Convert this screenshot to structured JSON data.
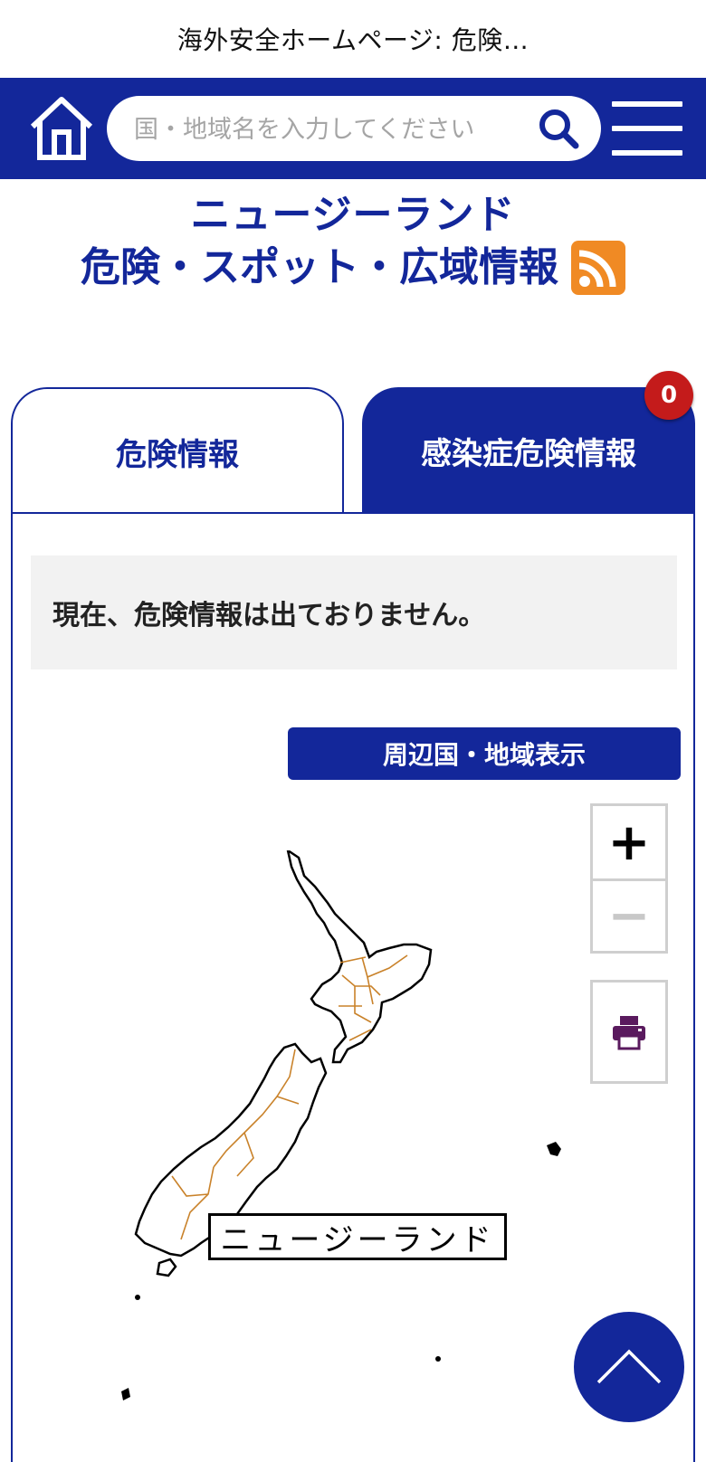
{
  "browser": {
    "page_title": "海外安全ホームページ: 危険…"
  },
  "header": {
    "search_placeholder": "国・地域名を入力してください",
    "colors": {
      "primary": "#13279a"
    }
  },
  "page": {
    "title_line1": "ニュージーランド",
    "title_line2": "危険・スポット・広域情報"
  },
  "tabs": [
    {
      "label": "危険情報",
      "active": true
    },
    {
      "label": "感染症危険情報",
      "active": false,
      "badge": "0"
    }
  ],
  "notice": "現在、危険情報は出ておりません。",
  "map": {
    "nearby_button": "周辺国・地域表示",
    "zoom_in": "+",
    "zoom_out": "−",
    "country_label": "ニュージーランド",
    "icons": [
      "print-icon"
    ]
  }
}
